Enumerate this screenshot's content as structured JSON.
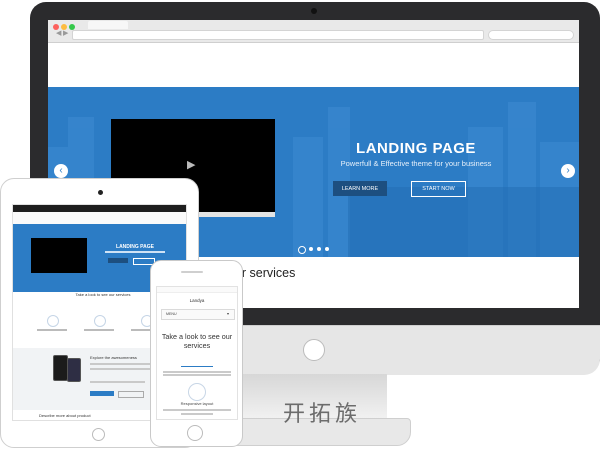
{
  "desktop": {
    "hero": {
      "title": "LANDING PAGE",
      "subtitle": "Powerfull & Effective theme for your business",
      "learn_more": "LEARN MORE",
      "start_now": "START NOW",
      "prev_icon": "chevron-left-icon",
      "next_icon": "chevron-right-icon",
      "play_icon": "play-icon"
    },
    "services_heading": "ake a look to see our services"
  },
  "tablet": {
    "hero_title": "LANDING PAGE",
    "take_look": "Take a look to see our services",
    "explore": "Explore the awesomeness",
    "describe": "Describe more about product"
  },
  "phone": {
    "logo": "Landya",
    "menu_label": "MENU",
    "menu_caret": "▾",
    "take_look": "Take a look to see our services",
    "responsive": "Responsive layout"
  },
  "watermark": "开拓族",
  "colors": {
    "accent": "#2c7cc5",
    "button_dark": "#1d4f80",
    "frame": "#2b2b2d"
  }
}
